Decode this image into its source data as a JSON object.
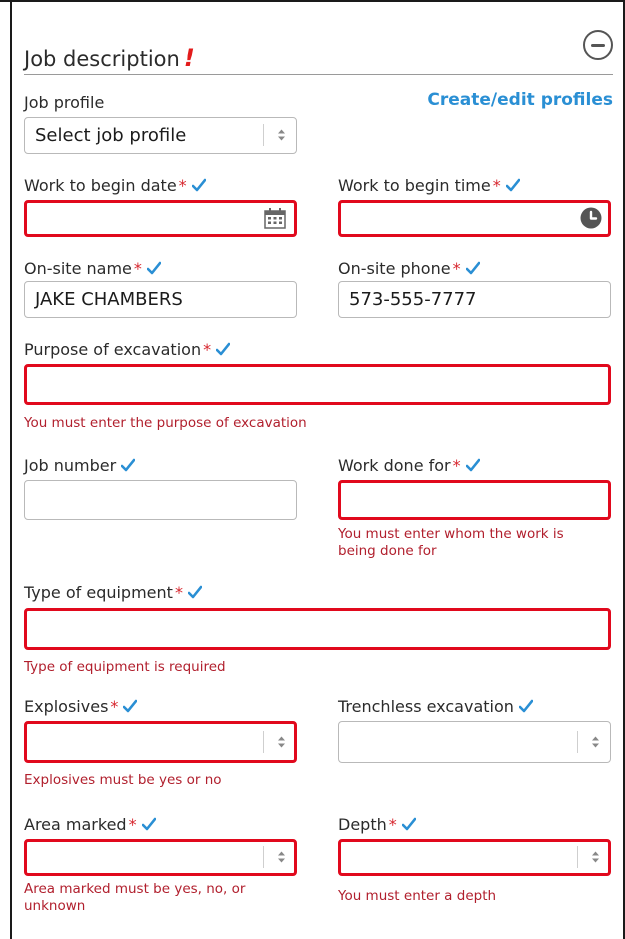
{
  "header": {
    "title": "Job description",
    "title_mark": "!",
    "collapse_icon": "minus-circle-icon"
  },
  "job_profile": {
    "label": "Job profile",
    "value": "Select job profile",
    "link": "Create/edit profiles"
  },
  "work_begin_date": {
    "label": "Work to begin date",
    "required": "*",
    "value": ""
  },
  "work_begin_time": {
    "label": "Work to begin time",
    "required": "*",
    "value": ""
  },
  "onsite_name": {
    "label": "On-site name",
    "required": "*",
    "value": "JAKE CHAMBERS"
  },
  "onsite_phone": {
    "label": "On-site phone",
    "required": "*",
    "value": "573-555-7777"
  },
  "purpose": {
    "label": "Purpose of excavation",
    "required": "*",
    "value": "",
    "error": "You must enter the purpose of excavation"
  },
  "job_number": {
    "label": "Job number",
    "value": ""
  },
  "work_done_for": {
    "label": "Work done for",
    "required": "*",
    "value": "",
    "error_line1": "You must enter whom the work is",
    "error_line2": "being done for"
  },
  "equipment": {
    "label": "Type of equipment",
    "required": "*",
    "value": "",
    "error": "Type of equipment is required"
  },
  "explosives": {
    "label": "Explosives",
    "required": "*",
    "value": "",
    "error": "Explosives must be yes or no"
  },
  "trenchless": {
    "label": "Trenchless excavation",
    "value": ""
  },
  "area_marked": {
    "label": "Area marked",
    "required": "*",
    "value": "",
    "error_line1": "Area marked must be yes, no, or",
    "error_line2": "unknown"
  },
  "depth": {
    "label": "Depth",
    "required": "*",
    "value": "",
    "error": "You must enter a depth"
  },
  "colors": {
    "accent": "#2a8fd4",
    "error": "#e1091d",
    "error_text": "#b11f2d",
    "required": "#d7262e"
  }
}
